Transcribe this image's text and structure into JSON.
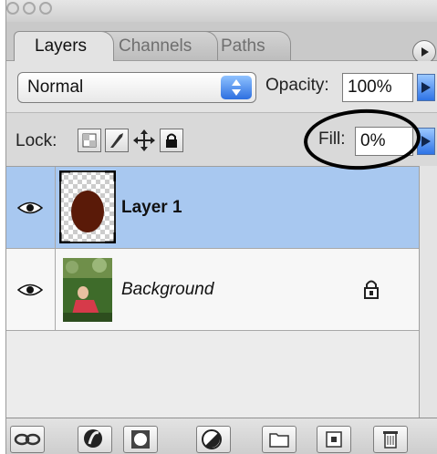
{
  "tabs": [
    {
      "label": "Layers",
      "active": true
    },
    {
      "label": "Channels",
      "active": false
    },
    {
      "label": "Paths",
      "active": false
    }
  ],
  "blend_mode": "Normal",
  "opacity": {
    "label": "Opacity:",
    "value": "100%"
  },
  "lock": {
    "label": "Lock:",
    "buttons": [
      "lock-transparent-pixels-icon",
      "lock-image-pixels-icon",
      "lock-position-icon",
      "lock-all-icon"
    ]
  },
  "fill": {
    "label": "Fill:",
    "value": "0%",
    "highlight_color": "#000000"
  },
  "layers": [
    {
      "name": "Layer 1",
      "selected": true,
      "visible": true,
      "thumbnail": "brown-oval-on-transparent"
    },
    {
      "name": "Background",
      "selected": false,
      "visible": true,
      "locked": true,
      "thumbnail": "photo-girl-red-dress"
    }
  ],
  "colors": {
    "selection": "#a8c8f0",
    "accent_blue": "#2e73e6",
    "oval_fill": "#5a1a08"
  },
  "toolbar_icons": [
    "link-layers-icon",
    "layer-style-icon",
    "layer-mask-icon",
    "adjustment-layer-icon",
    "new-group-icon",
    "new-layer-icon",
    "delete-layer-icon"
  ]
}
